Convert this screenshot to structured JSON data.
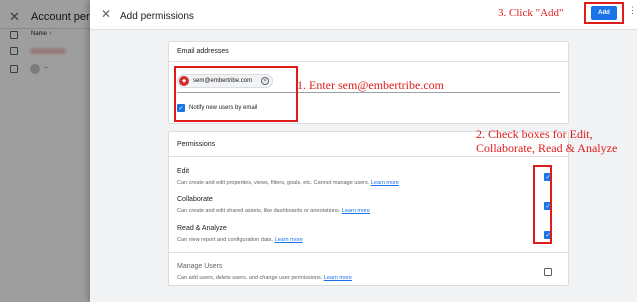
{
  "background": {
    "title": "Account perm",
    "column_name": "Name",
    "row2_text": "–"
  },
  "panel": {
    "title": "Add permissions",
    "add_label": "Add"
  },
  "email_section": {
    "heading": "Email addresses",
    "chip_email": "sem@embertribe.com",
    "notify_label": "Notify new users by email",
    "notify_checked": true
  },
  "permissions_section": {
    "heading": "Permissions",
    "learn_more": "Learn more",
    "items": [
      {
        "name": "Edit",
        "desc": "Can create and edit properties, views, filters, goals, etc. Cannot manage users.",
        "checked": true
      },
      {
        "name": "Collaborate",
        "desc": "Can create and edit shared assets, like dashboards or annotations.",
        "checked": true
      },
      {
        "name": "Read & Analyze",
        "desc": "Can view report and configuration data.",
        "checked": true
      },
      {
        "name": "Manage Users",
        "desc": "Can add users, delete users, and change user permissions.",
        "checked": false
      }
    ]
  },
  "annotations": {
    "step1": "1. Enter sem@embertribe.com",
    "step2": "2. Check boxes for Edit,\nCollaborate, Read & Analyze",
    "step3": "3. Click \"Add\""
  },
  "colors": {
    "accent": "#1a73e8",
    "annotation": "#e01b1b"
  }
}
